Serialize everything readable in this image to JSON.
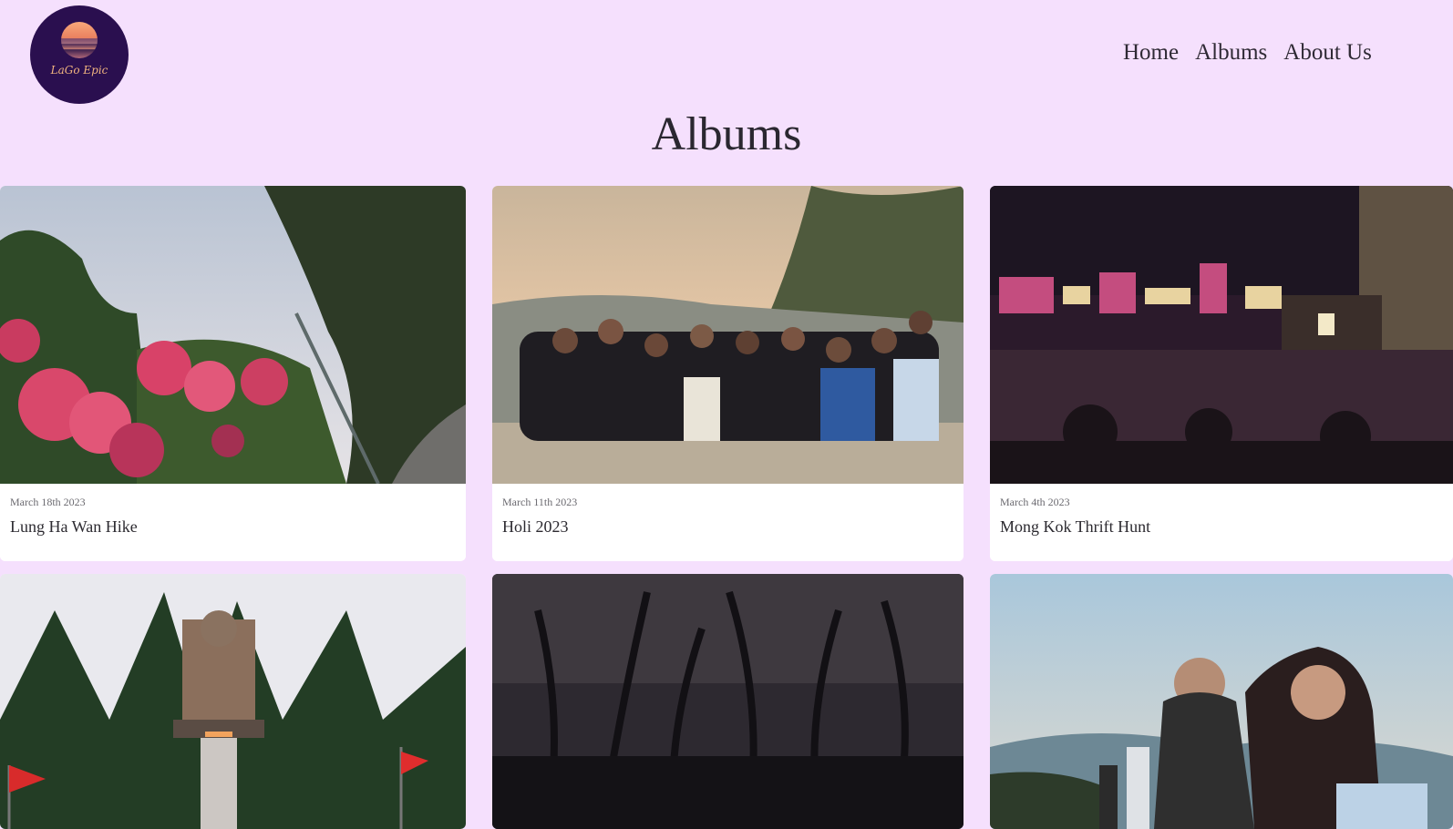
{
  "header": {
    "logo_text": "LaGo Epic",
    "nav": [
      {
        "label": "Home"
      },
      {
        "label": "Albums"
      },
      {
        "label": "About Us"
      }
    ]
  },
  "page": {
    "title": "Albums"
  },
  "albums": [
    {
      "date": "March 18th 2023",
      "title": "Lung Ha Wan Hike",
      "photo": "flowers-hillside"
    },
    {
      "date": "March 11th 2023",
      "title": "Holi 2023",
      "photo": "group-beach"
    },
    {
      "date": "March 4th 2023",
      "title": "Mong Kok Thrift Hunt",
      "photo": "city-night-skyline"
    },
    {
      "date": "",
      "title": "",
      "photo": "big-buddha"
    },
    {
      "date": "",
      "title": "",
      "photo": "dark-forest"
    },
    {
      "date": "",
      "title": "",
      "photo": "friends-mountain"
    }
  ],
  "colors": {
    "background": "#f5e0fd",
    "logo_bg": "#2a0f4f",
    "logo_text": "#f1b47f",
    "text": "#2c2a30"
  }
}
